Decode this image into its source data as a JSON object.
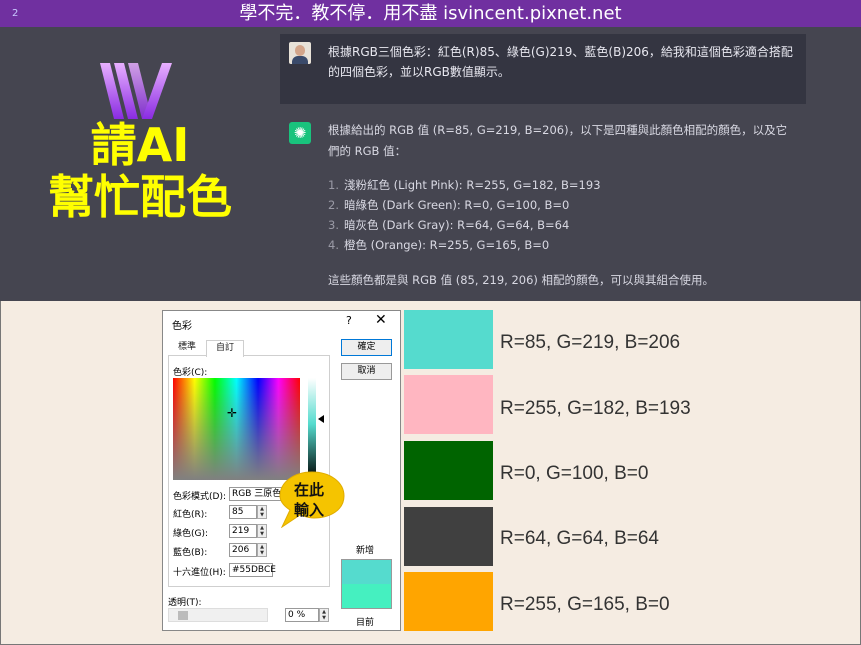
{
  "banner": {
    "page_number": "2",
    "title": "學不完．教不停．用不盡 isvincent.pixnet.net"
  },
  "promo": {
    "line1": "請AI",
    "line2": "幫忙配色",
    "logo_icon": "vincent-logo-icon"
  },
  "chat": {
    "question": "根據RGB三個色彩：紅色(R)85、綠色(G)219、藍色(B)206，給我和這個色彩適合搭配的四個色彩，並以RGB數值顯示。",
    "answer_intro": "根據給出的 RGB 值 (R=85, G=219, B=206)，以下是四種與此顏色相配的顏色，以及它們的 RGB 值：",
    "answer_items": [
      {
        "num": "1.",
        "text": "淺粉紅色 (Light Pink): R=255, G=182, B=193"
      },
      {
        "num": "2.",
        "text": "暗綠色 (Dark Green): R=0, G=100, B=0"
      },
      {
        "num": "3.",
        "text": "暗灰色 (Dark Gray): R=64, G=64, B=64"
      },
      {
        "num": "4.",
        "text": "橙色 (Orange): R=255, G=165, B=0"
      }
    ],
    "answer_footer": "這些顏色都是與 RGB 值 (85, 219, 206) 相配的顏色，可以與其組合使用。"
  },
  "dialog": {
    "title": "色彩",
    "help": "?",
    "close": "✕",
    "tabs": [
      "標準",
      "自訂"
    ],
    "colors_label": "色彩(C):",
    "model_label": "色彩模式(D):",
    "model_value": "RGB 三原色",
    "red_label": "紅色(R):",
    "red_value": "85",
    "green_label": "綠色(G):",
    "green_value": "219",
    "blue_label": "藍色(B):",
    "blue_value": "206",
    "hex_label": "十六進位(H):",
    "hex_value": "#55DBCE",
    "ok": "確定",
    "cancel": "取消",
    "new_label": "新增",
    "current_label": "目前",
    "transparency_label": "透明(T):",
    "transparency_value": "0 %",
    "new_color": "#55dbce",
    "current_color": "#45f0c0"
  },
  "callout": {
    "text": "在此輸入",
    "line1": "在此",
    "line2": "輸入"
  },
  "swatches": [
    {
      "color": "#55dbce",
      "label": "R=85, G=219, B=206"
    },
    {
      "color": "#ffb6c1",
      "label": "R=255, G=182, B=193"
    },
    {
      "color": "#006400",
      "label": "R=0, G=100, B=0"
    },
    {
      "color": "#404040",
      "label": "R=64, G=64, B=64"
    },
    {
      "color": "#ffa500",
      "label": "R=255, G=165, B=0"
    }
  ]
}
